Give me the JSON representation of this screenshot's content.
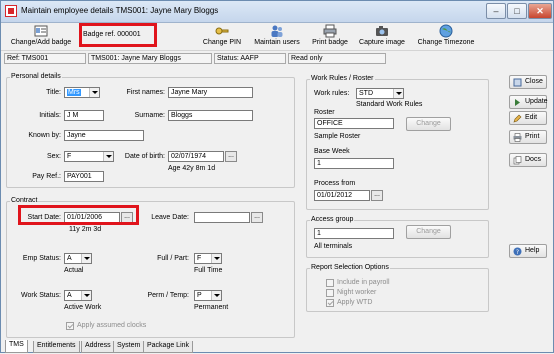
{
  "window": {
    "title": "Maintain employee details TMS001: Jayne Mary Bloggs"
  },
  "toolbar": {
    "change_add_badge": "Change/Add badge",
    "badge_ref": "Badge ref. 000001",
    "change_pin": "Change PIN",
    "maintain_users": "Maintain users",
    "print_badge": "Print badge",
    "capture_image": "Capture image",
    "change_timezone": "Change Timezone"
  },
  "status_bar": {
    "ref": "Ref: TMS001",
    "name": "TMS001: Jayne Mary Bloggs",
    "status": "Status: AAFP",
    "mode": "Read only"
  },
  "personal": {
    "group_title": "Personal details",
    "title_label": "Title:",
    "title_value": "Mrs",
    "first_names_label": "First names:",
    "first_names_value": "Jayne Mary",
    "initials_label": "Initials:",
    "initials_value": "J M",
    "surname_label": "Surname:",
    "surname_value": "Bloggs",
    "known_by_label": "Known by:",
    "known_by_value": "Jayne",
    "sex_label": "Sex:",
    "sex_value": "F",
    "dob_label": "Date of birth:",
    "dob_value": "02/07/1974",
    "age_text": "Age 42y 8m 1d",
    "pay_ref_label": "Pay Ref.:",
    "pay_ref_value": "PAY001"
  },
  "contract": {
    "group_title": "Contract",
    "start_date_label": "Start Date:",
    "start_date_value": "01/01/2006",
    "service_text": "11y 2m 3d",
    "leave_date_label": "Leave Date:",
    "leave_date_value": "",
    "emp_status_label": "Emp Status:",
    "emp_status_value": "A",
    "emp_status_desc": "Actual",
    "full_part_label": "Full / Part:",
    "full_part_value": "F",
    "full_part_desc": "Full Time",
    "work_status_label": "Work Status:",
    "work_status_value": "A",
    "work_status_desc": "Active Work",
    "perm_temp_label": "Perm / Temp:",
    "perm_temp_value": "P",
    "perm_temp_desc": "Permanent",
    "apply_assumed_clocks": "Apply assumed clocks"
  },
  "work_rules": {
    "group_title": "Work Rules / Roster",
    "work_rules_label": "Work rules:",
    "work_rules_value": "STD",
    "work_rules_desc": "Standard Work Rules",
    "roster_label": "Roster",
    "roster_value": "OFFICE",
    "roster_desc": "Sample Roster",
    "change_label": "Change",
    "base_week_label": "Base Week",
    "base_week_value": "1",
    "process_from_label": "Process from",
    "process_from_value": "01/01/2012"
  },
  "access": {
    "group_title": "Access group",
    "value": "1",
    "desc": "All terminals",
    "change_label": "Change"
  },
  "report": {
    "group_title": "Report Selection Options",
    "include_payroll": "Include in payroll",
    "night_worker": "Night worker",
    "apply_wtd": "Apply WTD"
  },
  "side_buttons": {
    "close": "Close",
    "update": "Update",
    "edit": "Edit",
    "print": "Print",
    "docs": "Docs",
    "help": "Help"
  },
  "tabs": [
    "TMS",
    "Entitlements",
    "Address",
    "System",
    "Package Link"
  ]
}
